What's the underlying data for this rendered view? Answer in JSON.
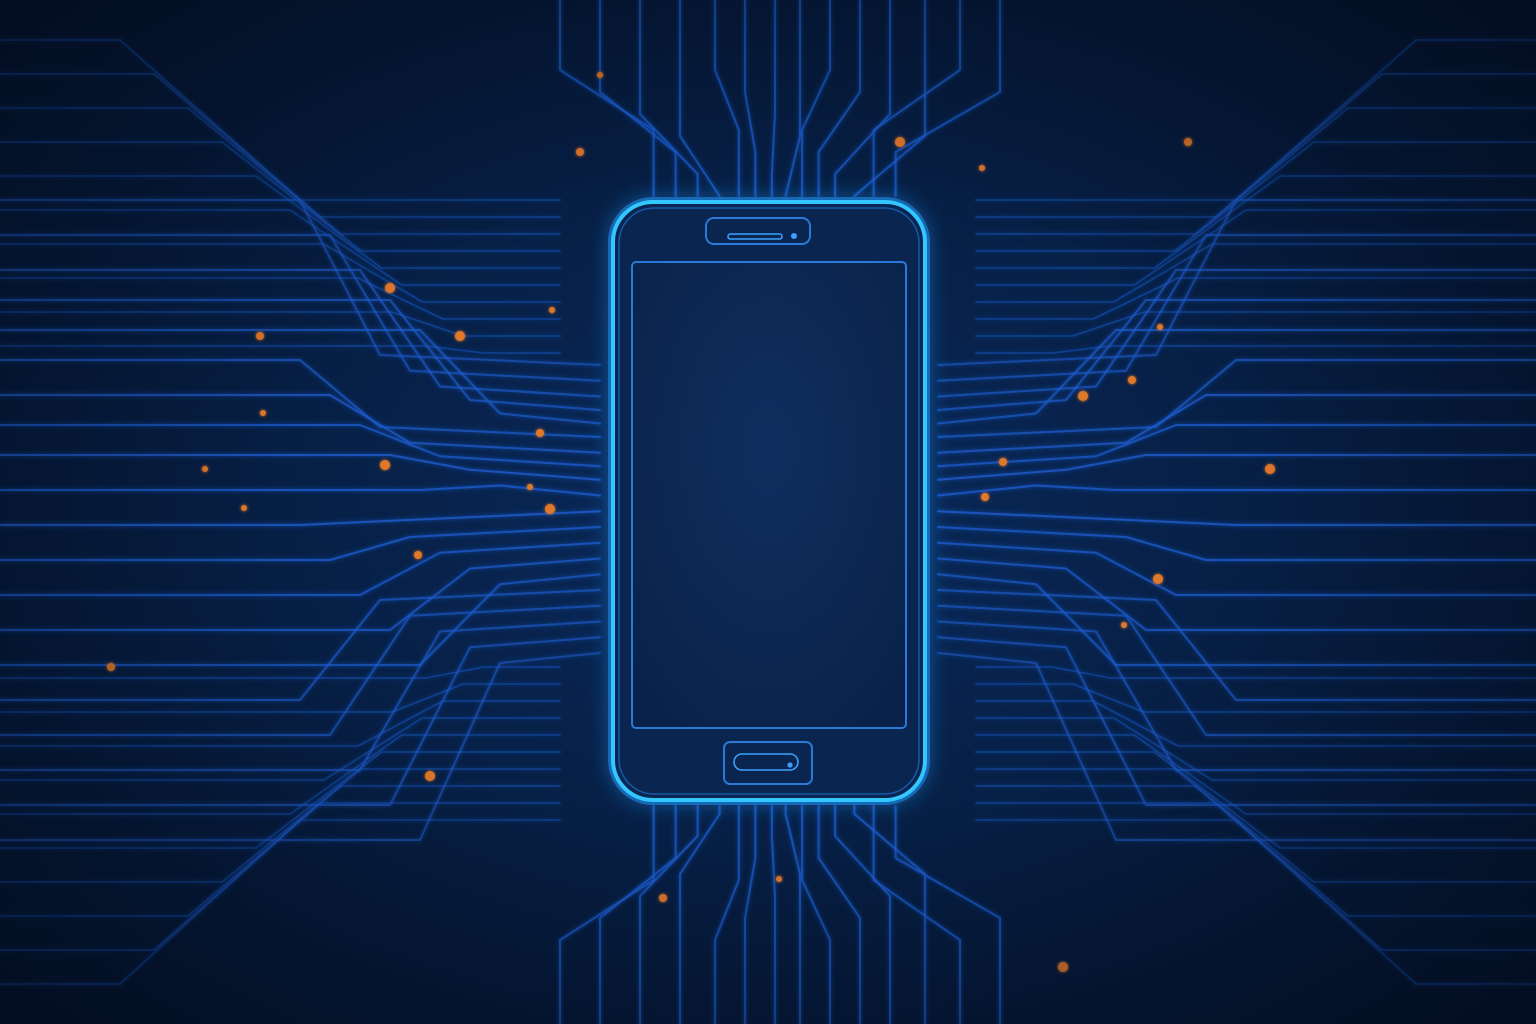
{
  "scene": {
    "subject": "smartphone",
    "icons": [
      "smartphone-icon",
      "speaker-grille-icon",
      "front-camera-icon",
      "home-button-icon"
    ],
    "screen_content": ""
  },
  "colors": {
    "background_center": "#0a2a5c",
    "background_edge": "#04142e",
    "trace": "#1d5fd6",
    "trace_glow": "#2b7bff",
    "phone_outline": "#33c6ff",
    "phone_body": "#0a2650",
    "screen_fill": "#0d2a55",
    "dot": "#e0782a"
  }
}
